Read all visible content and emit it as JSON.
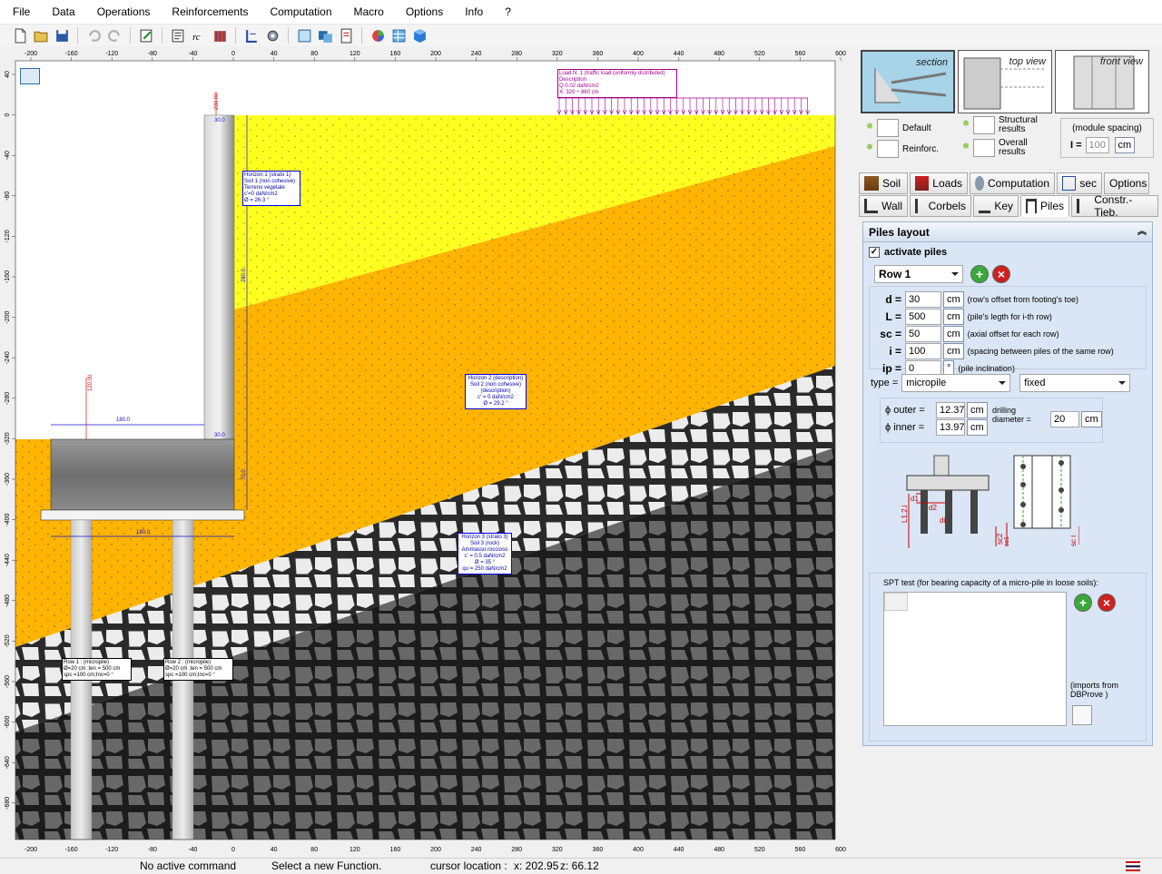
{
  "menu": [
    "File",
    "Data",
    "Operations",
    "Reinforcements",
    "Computation",
    "Macro",
    "Options",
    "Info",
    "?"
  ],
  "ruler": {
    "x_ticks": [
      "-200",
      "-160",
      "-120",
      "-80",
      "-40",
      "0",
      "40",
      "80",
      "120",
      "160",
      "200",
      "240",
      "280",
      "320",
      "360",
      "400",
      "440",
      "480",
      "520",
      "560",
      "600"
    ],
    "y_ticks": [
      "40",
      "0",
      "-40",
      "-80",
      "-120",
      "-160",
      "-200",
      "-240",
      "-280",
      "-320",
      "-360",
      "-400",
      "-440",
      "-480",
      "-520",
      "-560",
      "-600",
      "-640",
      "-680"
    ]
  },
  "drawing": {
    "load_label": [
      "Load N. 1 (traffic load (uniformly distributed)",
      "Description",
      "Q:0.02 daN/cm2",
      "X: 320 ÷ 860 cm"
    ],
    "horizon1": [
      "Horizon 1 (strato 1)",
      "Soil 1 (non cohesive)",
      "Terreno vegetale",
      "c'=0 daN/cm2",
      "Ø = 26.3 °"
    ],
    "horizon2": [
      "Horizon 2 (description)",
      "Soil 2 (non cohesive)",
      "(description)",
      "c' = 0 daN/cm2",
      "Ø = 29.2 °"
    ],
    "horizon3": [
      "Horizon 3 (strato 3)",
      "Soil 3 (rock)",
      "Ammasso roccioso",
      "c' = 0.5 daN/cm2",
      "Ø = 35 °",
      "qu = 250 daN/cm2"
    ],
    "row1_label": [
      "Row 1 : (micropile)",
      "Ø=20 cm ;len = 500 cm",
      "spc =100 cm;Inc=0 °"
    ],
    "row2_label": [
      "Row 2 : (micropile)",
      "Ø=20 cm ;len = 500 cm",
      "spc =100 cm;Inc=0 °"
    ],
    "dim_top": "30.0",
    "dim_footing": "180.0",
    "dim_base": "180.0",
    "dim_wall_height": "280.0",
    "dim_stem": "30.0",
    "dim_left_load": "120.00",
    "dim_footing_h": "70.0",
    "dim_top_load": "230.00"
  },
  "views": {
    "section": "section",
    "top": "top view",
    "front": "front view"
  },
  "results": {
    "default": "Default",
    "reinforc": "Reinforc.",
    "structural": "Structural results",
    "overall": "Overall results"
  },
  "module": {
    "title": "(module spacing)",
    "label": "I =",
    "value": "100",
    "unit": "cm"
  },
  "tabs_row1": [
    "Soil",
    "Loads",
    "Computation",
    "sec",
    "Options"
  ],
  "tabs_row2": [
    "Wall",
    "Corbels",
    "Key",
    "Piles",
    "Constr.-Tieb."
  ],
  "piles": {
    "header": "Piles layout",
    "activate": "activate piles",
    "row_select": "Row 1",
    "fields": [
      {
        "label": "d =",
        "value": "30",
        "unit": "cm",
        "hint": "(row's offset from footing's toe)"
      },
      {
        "label": "L =",
        "value": "500",
        "unit": "cm",
        "hint": "(pile's legth for i-th row)"
      },
      {
        "label": "sc =",
        "value": "50",
        "unit": "cm",
        "hint": "(axial offset for each row)"
      },
      {
        "label": "i =",
        "value": "100",
        "unit": "cm",
        "hint": "(spacing between piles of the same row)"
      },
      {
        "label": "ip =",
        "value": "0",
        "unit": "°",
        "hint": "(pile inclination)"
      }
    ],
    "type_label": "type =",
    "type_value": "micropile",
    "fix_value": "fixed",
    "outer_label": "ϕ outer =",
    "outer_value": "12.37",
    "inner_label": "ϕ inner =",
    "inner_value": "13.97",
    "cm": "cm",
    "drilling_label": "drilling diameter =",
    "drilling_value": "20",
    "diagram_labels": {
      "d1": "d1",
      "d2": "d2",
      "di": "di",
      "li": "L1,2,i",
      "sc2": "sc2",
      "sc1": "sc1",
      "sci": "sc i"
    },
    "spt_label": "SPT test (for bearing capacity of a micro-pile in loose soils):",
    "imports": "(imports from DBProve )"
  },
  "status": {
    "command": "No active command",
    "prompt": "Select a new Function.",
    "cursor_label": "cursor location :",
    "cursor_x": "x: 202.95",
    "cursor_z": "z: 66.12"
  }
}
